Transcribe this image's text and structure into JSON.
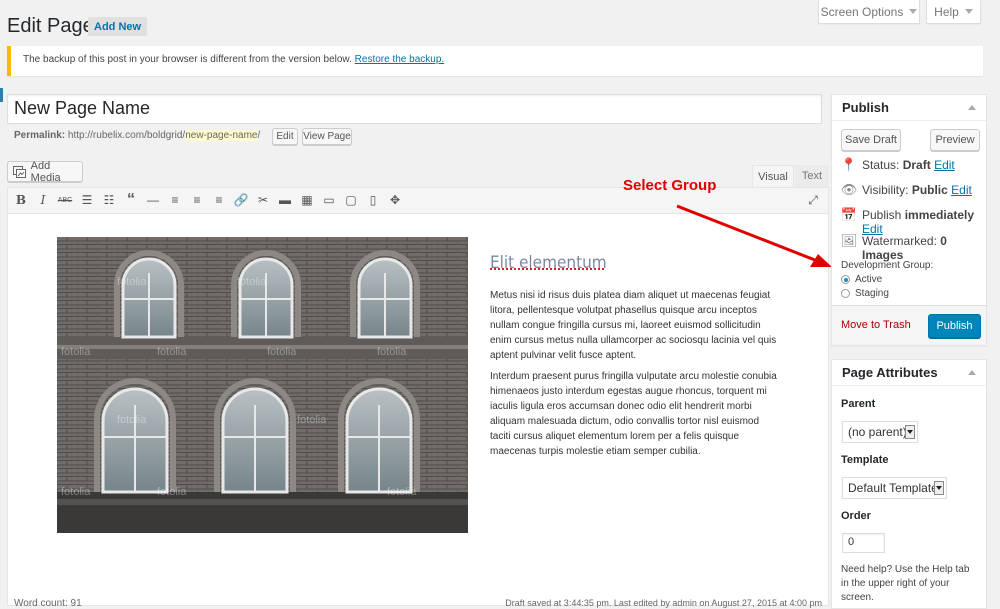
{
  "header": {
    "title": "Edit Page",
    "add_new": "Add New",
    "screen_options": "Screen Options",
    "help": "Help"
  },
  "notice": {
    "text": "The backup of this post in your browser is different from the version below.",
    "link": "Restore the backup."
  },
  "post": {
    "title_value": "New Page Name",
    "permalink_label": "Permalink:",
    "permalink_base": "http://rubelix.com/boldgrid/",
    "permalink_slug": "new-page-name",
    "permalink_end": "/",
    "edit_btn": "Edit",
    "view_btn": "View Page"
  },
  "editor": {
    "add_media": "Add Media",
    "tab_visual": "Visual",
    "tab_text": "Text",
    "toolbar": [
      "bold-icon",
      "italic-icon",
      "strikethrough-icon",
      "bullet-list-icon",
      "numbered-list-icon",
      "blockquote-icon",
      "horizontal-rule-icon",
      "align-left-icon",
      "align-center-icon",
      "align-right-icon",
      "link-icon",
      "unlink-icon",
      "read-more-icon",
      "toolbar-toggle-icon",
      "device-desktop-icon",
      "device-tablet-icon",
      "device-mobile-icon",
      "move-icon"
    ],
    "heading": "Elit elementum",
    "para1": "Metus nisi id risus duis platea diam aliquet ut maecenas feugiat litora, pellentesque volutpat phasellus quisque arcu inceptos nullam congue fringilla cursus mi, laoreet euismod sollicitudin enim cursus metus nulla ullamcorper ac sociosqu lacinia vel quis aptent pulvinar velit fusce aptent.",
    "para2": "Interdum praesent purus fringilla vulputate arcu molestie conubia himenaeos justo interdum egestas augue rhoncus, torquent mi iaculis ligula eros accumsan donec odio elit hendrerit morbi aliquam malesuada dictum, odio convallis tortor nisl euismod taciti cursus aliquet elementum lorem per a felis quisque maecenas turpis molestie etiam semper cubilia.",
    "watermark": "fotolia",
    "word_count": "Word count: 91",
    "draft_status": "Draft saved at 3:44:35 pm. Last edited by admin on August 27, 2015 at 4:00 pm"
  },
  "annotation": {
    "label": "Select Group",
    "color": "#e00000"
  },
  "publish": {
    "title": "Publish",
    "save_draft": "Save Draft",
    "preview": "Preview",
    "status_label": "Status:",
    "status_value": "Draft",
    "visibility_label": "Visibility:",
    "visibility_value": "Public",
    "publish_label": "Publish",
    "publish_value": "immediately",
    "edit": "Edit",
    "watermarked_label": "Watermarked:",
    "watermarked_value": "0 Images",
    "dev_group_label": "Development Group:",
    "dev_options": [
      "Active",
      "Staging"
    ],
    "move_to_trash": "Move to Trash",
    "publish_btn": "Publish",
    "publish_btn_color": "#0085ba",
    "trash_color": "#a00"
  },
  "attributes": {
    "title": "Page Attributes",
    "parent_label": "Parent",
    "parent_value": "(no parent)",
    "template_label": "Template",
    "template_value": "Default Template",
    "order_label": "Order",
    "order_value": "0",
    "help_text": "Need help? Use the Help tab in the upper right of your screen."
  }
}
